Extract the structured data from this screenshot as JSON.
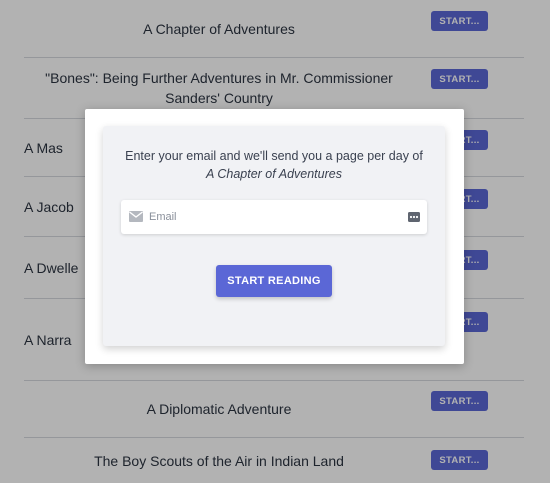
{
  "books": [
    {
      "title": "A Chapter of Adventures",
      "button": "START..."
    },
    {
      "title": "\"Bones\": Being Further Adventures in Mr. Commissioner Sanders' Country",
      "button": "START..."
    },
    {
      "title": "A Mas",
      "button": "START..."
    },
    {
      "title": "A Jacob",
      "button": "START..."
    },
    {
      "title": "A Dwelle",
      "button": "START..."
    },
    {
      "title": "A Narra                                   but R",
      "button": "START..."
    },
    {
      "title": "A Diplomatic Adventure",
      "button": "START..."
    },
    {
      "title": "The Boy Scouts of the Air in Indian Land",
      "button": "START..."
    }
  ],
  "modal": {
    "prompt_line1": "Enter your email and we'll send you a page per day of",
    "book_title": "A Chapter of Adventures",
    "email_placeholder": "Email",
    "email_value": "",
    "submit_label": "START READING"
  },
  "icons": {
    "mail": "mail-icon",
    "password_manager": "dots-icon"
  },
  "colors": {
    "accent": "#5b67d6",
    "overlay": "rgba(0,0,0,0.30)"
  }
}
